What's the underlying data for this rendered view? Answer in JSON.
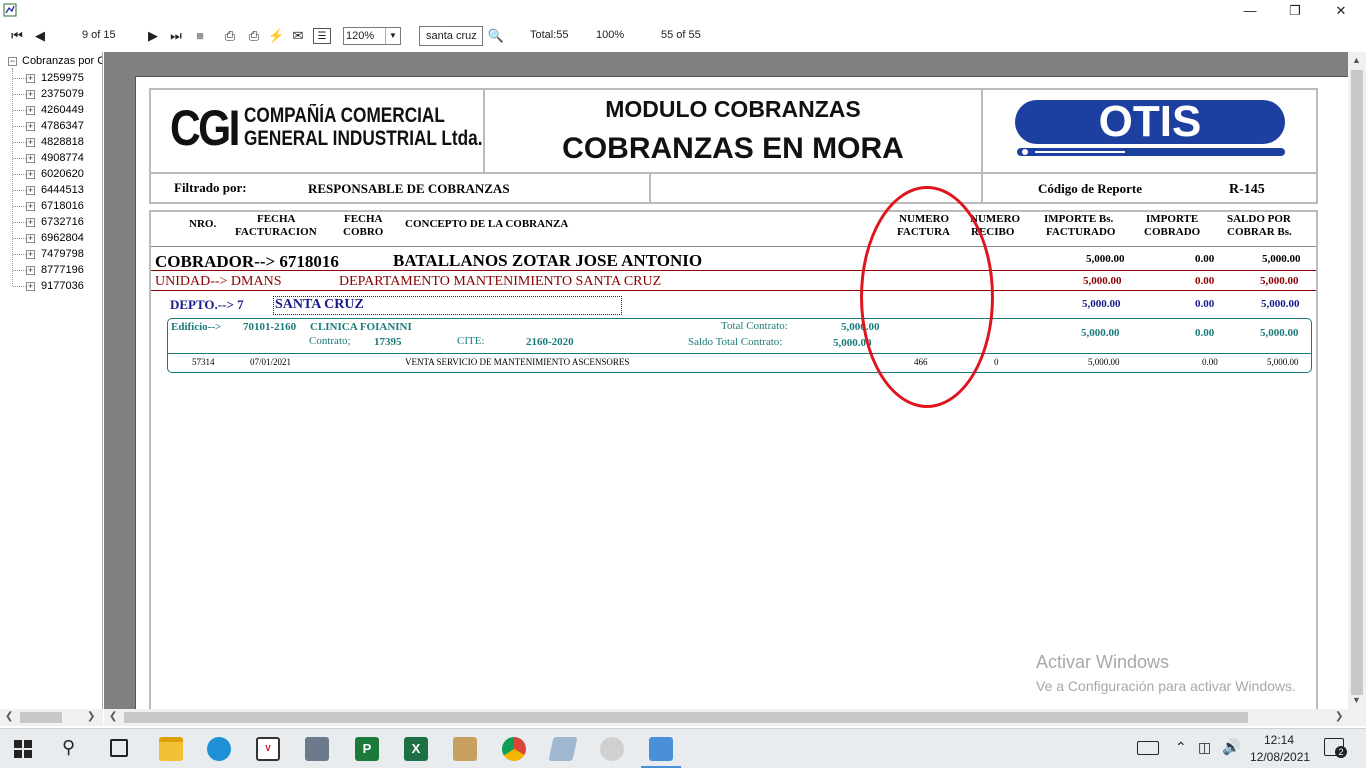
{
  "toolbar": {
    "page_indicator": "9 of 15",
    "zoom_value": "120%",
    "search_value": "santa cruz",
    "total_label": "Total:55",
    "percent_label": "100%",
    "record_count": "55 of 55"
  },
  "tree": {
    "root_label": "Cobranzas por C",
    "items": [
      "1259975",
      "2375079",
      "4260449",
      "4786347",
      "4828818",
      "4908774",
      "6020620",
      "6444513",
      "6718016",
      "6732716",
      "6962804",
      "7479798",
      "8777196",
      "9177036"
    ]
  },
  "report": {
    "company_logo_text": "CGI",
    "company_name_line1": "COMPAÑÍA COMERCIAL",
    "company_name_line2": "GENERAL INDUSTRIAL Ltda.",
    "module_title": "MODULO COBRANZAS",
    "report_title": "COBRANZAS EN MORA",
    "brand_logo": "OTIS",
    "filter_label": "Filtrado por:",
    "filter_value": "RESPONSABLE DE COBRANZAS",
    "report_code_label": "Código de Reporte",
    "report_code_value": "R-145",
    "columns": {
      "nro": "NRO.",
      "fecha_fact_1": "FECHA",
      "fecha_fact_2": "FACTURACION",
      "fecha_cobro_1": "FECHA",
      "fecha_cobro_2": "COBRO",
      "concepto": "CONCEPTO DE LA COBRANZA",
      "numero_factura_1": "NUMERO",
      "numero_factura_2": "FACTURA",
      "numero_recibo_1": "NUMERO",
      "numero_recibo_2": "RECIBO",
      "importe_fact_1": "IMPORTE  Bs.",
      "importe_fact_2": "FACTURADO",
      "importe_cob_1": "IMPORTE",
      "importe_cob_2": "COBRADO",
      "saldo_1": "SALDO POR",
      "saldo_2": "COBRAR Bs."
    },
    "cobrador_label": "COBRADOR--> 6718016",
    "cobrador_name": "BATALLANOS ZOTAR JOSE ANTONIO",
    "cobrador_facturado": "5,000.00",
    "cobrador_cobrado": "0.00",
    "cobrador_saldo": "5,000.00",
    "unidad_label": "UNIDAD-->  DMANS",
    "unidad_name": "DEPARTAMENTO MANTENIMIENTO SANTA CRUZ",
    "unidad_facturado": "5,000.00",
    "unidad_cobrado": "0.00",
    "unidad_saldo": "5,000.00",
    "depto_label": "DEPTO.--> 7",
    "depto_name": "SANTA CRUZ",
    "depto_facturado": "5,000.00",
    "depto_cobrado": "0.00",
    "depto_saldo": "5,000.00",
    "edificio_label": "Edificio-->",
    "edificio_code": "70101-2160",
    "edificio_name": "CLINICA FOIANINI",
    "contrato_label": "Contrato;",
    "contrato_value": "17395",
    "cite_label": "CITE:",
    "cite_value": "2160-2020",
    "total_contrato_label": "Total Contrato:",
    "total_contrato_value": "5,000.00",
    "saldo_contrato_label": "Saldo Total Contrato:",
    "saldo_contrato_value": "5,000.00",
    "edificio_facturado": "5,000.00",
    "edificio_cobrado": "0.00",
    "edificio_saldo": "5,000.00",
    "row": {
      "nro": "57314",
      "fecha": "07/01/2021",
      "concepto": "VENTA SERVICIO DE MANTENIMIENTO ASCENSORES",
      "factura": "466",
      "recibo": "0",
      "facturado": "5,000.00",
      "cobrado": "0.00",
      "saldo": "5,000.00"
    }
  },
  "watermark": {
    "line1": "Activar Windows",
    "line2": "Ve a Configuración para activar Windows."
  },
  "taskbar": {
    "time": "12:14",
    "date": "12/08/2021",
    "notification_count": "2"
  },
  "colors": {
    "annotation_circle": "#e0141e",
    "teal": "#1a7a7a",
    "navy": "#1a1a8a",
    "maroon": "#8b0000",
    "otis_blue": "#1d3fa0"
  }
}
